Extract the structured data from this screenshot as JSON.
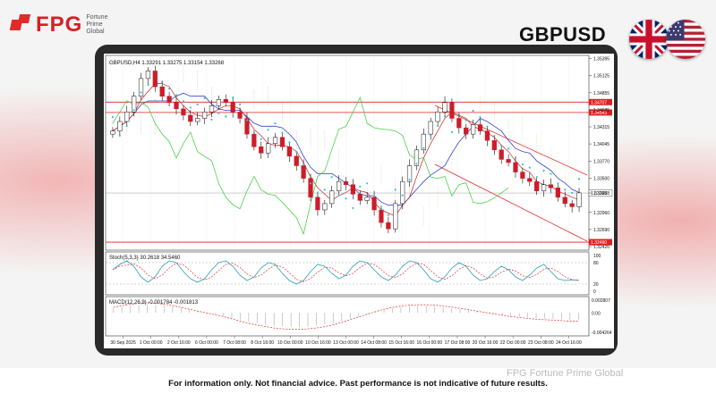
{
  "brand": {
    "name": "FPG",
    "subtitle": [
      "Fortune",
      "Prime",
      "Global"
    ]
  },
  "symbol": "GBPUSD",
  "flags": [
    "uk-flag-icon",
    "us-flag-icon"
  ],
  "chart_header": "GBPUSD,H4  1.33291 1.33275 1.33154 1.33268",
  "stoch_header": "Stoch(5,3,3) 30.2618 34.5460",
  "macd_header": "MACD(12,26,9) -0.001784 -0.001813",
  "footer": "For information only. Not financial advice. Past performance is not indicative of future results.",
  "watermark": "FPG Fortune Prime Global",
  "chart_data": {
    "type": "candlestick",
    "price_axis": [
      "1.35395",
      "1.35125",
      "1.34855",
      "1.34585",
      "1.34315",
      "1.34045",
      "1.33770",
      "1.33500",
      "1.33268",
      "1.32960",
      "1.32690",
      "1.32420"
    ],
    "price_range": [
      1.3242,
      1.3539
    ],
    "red_levels": [
      {
        "label": "1.34707",
        "value": 1.34707
      },
      {
        "label": "1.34543",
        "value": 1.34543
      },
      {
        "label": "1.32490",
        "value": 1.3249
      }
    ],
    "current_price": {
      "label": "1.33268",
      "value": 1.33268
    },
    "time_labels": [
      "30 Sep 2025",
      "1 Oct 00:00",
      "2 Oct 16:00",
      "6 Oct 00:00",
      "7 Oct 08:00",
      "8 Oct 16:00",
      "10 Oct 00:00",
      "10 Oct 16:00",
      "13 Oct 00:00",
      "14 Oct 08:00",
      "15 Oct 16:00",
      "16 Oct 00:00",
      "17 Oct 08:00",
      "20 Oct 16:00",
      "22 Oct 00:00",
      "23 Oct 08:00",
      "24 Oct 16:00"
    ],
    "closes": [
      1.3425,
      1.344,
      1.3455,
      1.348,
      1.3508,
      1.352,
      1.3495,
      1.348,
      1.347,
      1.346,
      1.345,
      1.344,
      1.3445,
      1.3455,
      1.3465,
      1.3475,
      1.347,
      1.3455,
      1.3445,
      1.342,
      1.34,
      1.339,
      1.3405,
      1.3415,
      1.34,
      1.3385,
      1.337,
      1.335,
      1.332,
      1.33,
      1.331,
      1.333,
      1.3345,
      1.334,
      1.3325,
      1.3315,
      1.332,
      1.33,
      1.328,
      1.327,
      1.331,
      1.3345,
      1.337,
      1.3395,
      1.342,
      1.344,
      1.3455,
      1.347,
      1.3445,
      1.343,
      1.342,
      1.3435,
      1.3425,
      1.341,
      1.3395,
      1.338,
      1.3375,
      1.336,
      1.335,
      1.3345,
      1.333,
      1.334,
      1.3335,
      1.332,
      1.331,
      1.3305,
      1.3327
    ],
    "stochastic": {
      "levels": [
        80,
        20
      ],
      "axis": [
        "100",
        "80",
        "20",
        "0"
      ],
      "k": [
        60,
        75,
        85,
        70,
        40,
        25,
        40,
        70,
        85,
        80,
        55,
        35,
        25,
        35,
        60,
        80,
        85,
        70,
        45,
        30,
        40,
        65,
        80,
        75,
        50,
        30,
        20,
        30,
        55,
        75,
        70,
        50,
        35,
        45,
        70,
        85,
        80,
        60,
        40,
        30,
        45,
        70,
        85,
        80,
        60,
        35,
        25,
        40,
        65,
        80,
        70,
        45,
        30,
        35,
        55,
        70,
        60,
        40,
        30,
        45,
        65,
        75,
        55,
        35,
        30,
        32,
        30
      ]
    },
    "macd": {
      "axis": [
        "0.002807",
        "0.00",
        "-0.004264"
      ],
      "signal": [
        0.0012,
        0.0016,
        0.0019,
        0.0021,
        0.0022,
        0.0021,
        0.0019,
        0.0016,
        0.0012,
        0.0008,
        0.0004,
        0.0,
        -0.0004,
        -0.0008,
        -0.0013,
        -0.0018,
        -0.0023,
        -0.0027,
        -0.003,
        -0.0033,
        -0.0035,
        -0.0036,
        -0.0036,
        -0.0035,
        -0.0033,
        -0.003,
        -0.0026,
        -0.0021,
        -0.0015,
        -0.0009,
        -0.0003,
        0.0003,
        0.0008,
        0.0012,
        0.0015,
        0.0017,
        0.0018,
        0.0018,
        0.0017,
        0.0015,
        0.0013,
        0.001,
        0.0007,
        0.0004,
        0.0001,
        -0.0002,
        -0.0005,
        -0.0008,
        -0.001,
        -0.0012,
        -0.0014,
        -0.0015,
        -0.0016,
        -0.0017,
        -0.0018,
        -0.0018
      ]
    }
  }
}
